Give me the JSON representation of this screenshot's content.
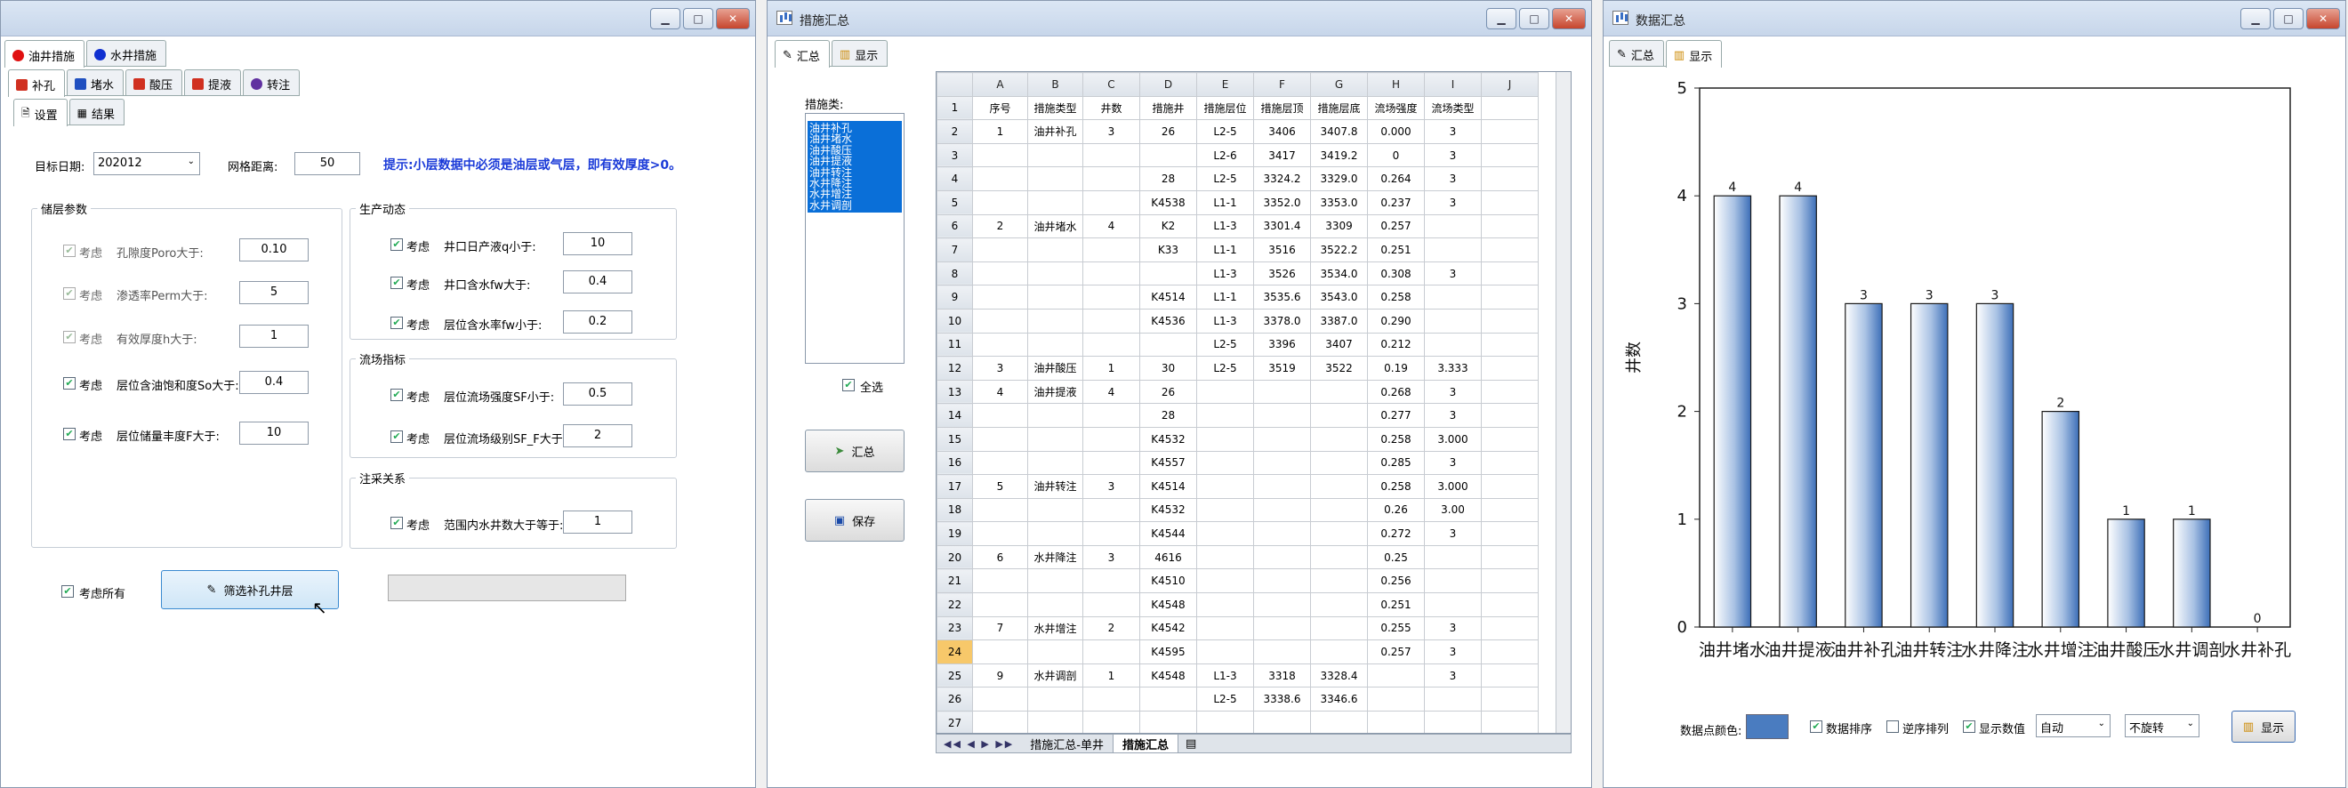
{
  "win1": {
    "top_tabs": [
      {
        "label": "油井措施",
        "color": "#e01010"
      },
      {
        "label": "水井措施",
        "color": "#1030d0"
      }
    ],
    "sub_tabs": [
      {
        "label": "补孔",
        "color": "#d03020"
      },
      {
        "label": "堵水",
        "color": "#2050c0"
      },
      {
        "label": "酸压",
        "color": "#d03020"
      },
      {
        "label": "提液",
        "color": "#d03020"
      },
      {
        "label": "转注",
        "color": "#6030a0"
      }
    ],
    "inner_tabs": [
      "设置",
      "结果"
    ],
    "target_date_label": "目标日期:",
    "target_date": "202012",
    "grid_dist_label": "网格距离:",
    "grid_dist": "50",
    "hint": "提示:小层数据中必须是油层或气层，即有效厚度>0。",
    "reservoir_group": "储层参数",
    "reservoir": [
      {
        "check": "考虑",
        "label": "孔隙度Poro大于:",
        "value": "0.10",
        "disabled": true
      },
      {
        "check": "考虑",
        "label": "渗透率Perm大于:",
        "value": "5",
        "disabled": true
      },
      {
        "check": "考虑",
        "label": "有效厚度h大于:",
        "value": "1",
        "disabled": true
      },
      {
        "check": "考虑",
        "label": "层位含油饱和度So大于:",
        "value": "0.4",
        "disabled": false
      },
      {
        "check": "考虑",
        "label": "层位储量丰度F大于:",
        "value": "10",
        "disabled": false
      }
    ],
    "prod_group": "生产动态",
    "prod": [
      {
        "check": "考虑",
        "label": "井口日产液q小于:",
        "value": "10"
      },
      {
        "check": "考虑",
        "label": "井口含水fw大于:",
        "value": "0.4"
      },
      {
        "check": "考虑",
        "label": "层位含水率fw小于:",
        "value": "0.2"
      }
    ],
    "flow_group": "流场指标",
    "flow": [
      {
        "check": "考虑",
        "label": "层位流场强度SF小于:",
        "value": "0.5"
      },
      {
        "check": "考虑",
        "label": "层位流场级别SF_F大于:",
        "value": "2"
      }
    ],
    "inj_group": "注采关系",
    "inj": [
      {
        "check": "考虑",
        "label": "范围内水井数大于等于:",
        "value": "1"
      }
    ],
    "consider_all": "考虑所有",
    "filter_button": "筛选补孔井层"
  },
  "win2": {
    "title": "措施汇总",
    "tabs": [
      "汇总",
      "显示"
    ],
    "category_label": "措施类:",
    "categories": [
      "油井补孔",
      "油井堵水",
      "油井酸压",
      "油井提液",
      "油井转注",
      "水井降注",
      "水井增注",
      "水井调剖"
    ],
    "select_all": "全选",
    "summary_button": "汇总",
    "save_button": "保存",
    "col_letters": [
      "A",
      "B",
      "C",
      "D",
      "E",
      "F",
      "G",
      "H",
      "I",
      "J"
    ],
    "headers": [
      "序号",
      "措施类型",
      "井数",
      "措施井",
      "措施层位",
      "措施层顶",
      "措施层底",
      "流场强度",
      "流场类型",
      ""
    ],
    "rows": [
      [
        "1",
        "油井补孔",
        "3",
        "26",
        "L2-5",
        "3406",
        "3407.8",
        "0.000",
        "3"
      ],
      [
        "",
        "",
        "",
        "",
        "L2-6",
        "3417",
        "3419.2",
        "0",
        "3"
      ],
      [
        "",
        "",
        "",
        "28",
        "L2-5",
        "3324.2",
        "3329.0",
        "0.264",
        "3"
      ],
      [
        "",
        "",
        "",
        "K4538",
        "L1-1",
        "3352.0",
        "3353.0",
        "0.237",
        "3"
      ],
      [
        "2",
        "油井堵水",
        "4",
        "K2",
        "L1-3",
        "3301.4",
        "3309",
        "0.257",
        ""
      ],
      [
        "",
        "",
        "",
        "K33",
        "L1-1",
        "3516",
        "3522.2",
        "0.251",
        ""
      ],
      [
        "",
        "",
        "",
        "",
        "L1-3",
        "3526",
        "3534.0",
        "0.308",
        "3"
      ],
      [
        "",
        "",
        "",
        "K4514",
        "L1-1",
        "3535.6",
        "3543.0",
        "0.258",
        ""
      ],
      [
        "",
        "",
        "",
        "K4536",
        "L1-3",
        "3378.0",
        "3387.0",
        "0.290",
        ""
      ],
      [
        "",
        "",
        "",
        "",
        "L2-5",
        "3396",
        "3407",
        "0.212",
        ""
      ],
      [
        "3",
        "油井酸压",
        "1",
        "30",
        "L2-5",
        "3519",
        "3522",
        "0.19",
        "3.333"
      ],
      [
        "4",
        "油井提液",
        "4",
        "26",
        "",
        "",
        "",
        "0.268",
        "3"
      ],
      [
        "",
        "",
        "",
        "28",
        "",
        "",
        "",
        "0.277",
        "3"
      ],
      [
        "",
        "",
        "",
        "K4532",
        "",
        "",
        "",
        "0.258",
        "3.000"
      ],
      [
        "",
        "",
        "",
        "K4557",
        "",
        "",
        "",
        "0.285",
        "3"
      ],
      [
        "5",
        "油井转注",
        "3",
        "K4514",
        "",
        "",
        "",
        "0.258",
        "3.000"
      ],
      [
        "",
        "",
        "",
        "K4532",
        "",
        "",
        "",
        "0.26",
        "3.00"
      ],
      [
        "",
        "",
        "",
        "K4544",
        "",
        "",
        "",
        "0.272",
        "3"
      ],
      [
        "6",
        "水井降注",
        "3",
        "4616",
        "",
        "",
        "",
        "0.25",
        ""
      ],
      [
        "",
        "",
        "",
        "K4510",
        "",
        "",
        "",
        "0.256",
        ""
      ],
      [
        "",
        "",
        "",
        "K4548",
        "",
        "",
        "",
        "0.251",
        ""
      ],
      [
        "7",
        "水井增注",
        "2",
        "K4542",
        "",
        "",
        "",
        "0.255",
        "3"
      ],
      [
        "",
        "",
        "",
        "K4595",
        "",
        "",
        "",
        "0.257",
        "3"
      ],
      [
        "9",
        "水井调剖",
        "1",
        "K4548",
        "L1-3",
        "3318",
        "3328.4",
        "",
        "3"
      ],
      [
        "",
        "",
        "",
        "",
        "L2-5",
        "3338.6",
        "3346.6",
        "",
        ""
      ]
    ],
    "sheet_tabs": [
      "措施汇总-单井",
      "措施汇总"
    ]
  },
  "win3": {
    "title": "数据汇总",
    "tabs": [
      "汇总",
      "显示"
    ],
    "color_label": "数据点颜色:",
    "cb_sort": "数据排序",
    "cb_reverse": "逆序排列",
    "cb_showval": "显示数值",
    "dd1": "自动",
    "dd2": "不旋转",
    "show_button": "显示"
  },
  "chart_data": {
    "type": "bar",
    "categories": [
      "油井堵水",
      "油井提液",
      "油井补孔",
      "油井转注",
      "水井降注",
      "水井增注",
      "油井酸压",
      "水井调剖",
      "水井补孔"
    ],
    "values": [
      4,
      4,
      3,
      3,
      3,
      2,
      1,
      1,
      0
    ],
    "ylabel": "井数",
    "xlabel": "",
    "ylim": [
      0,
      5
    ],
    "yticks": [
      "0",
      "1",
      "2",
      "3",
      "4",
      "5"
    ],
    "bar_color": "#3d6fb8"
  }
}
